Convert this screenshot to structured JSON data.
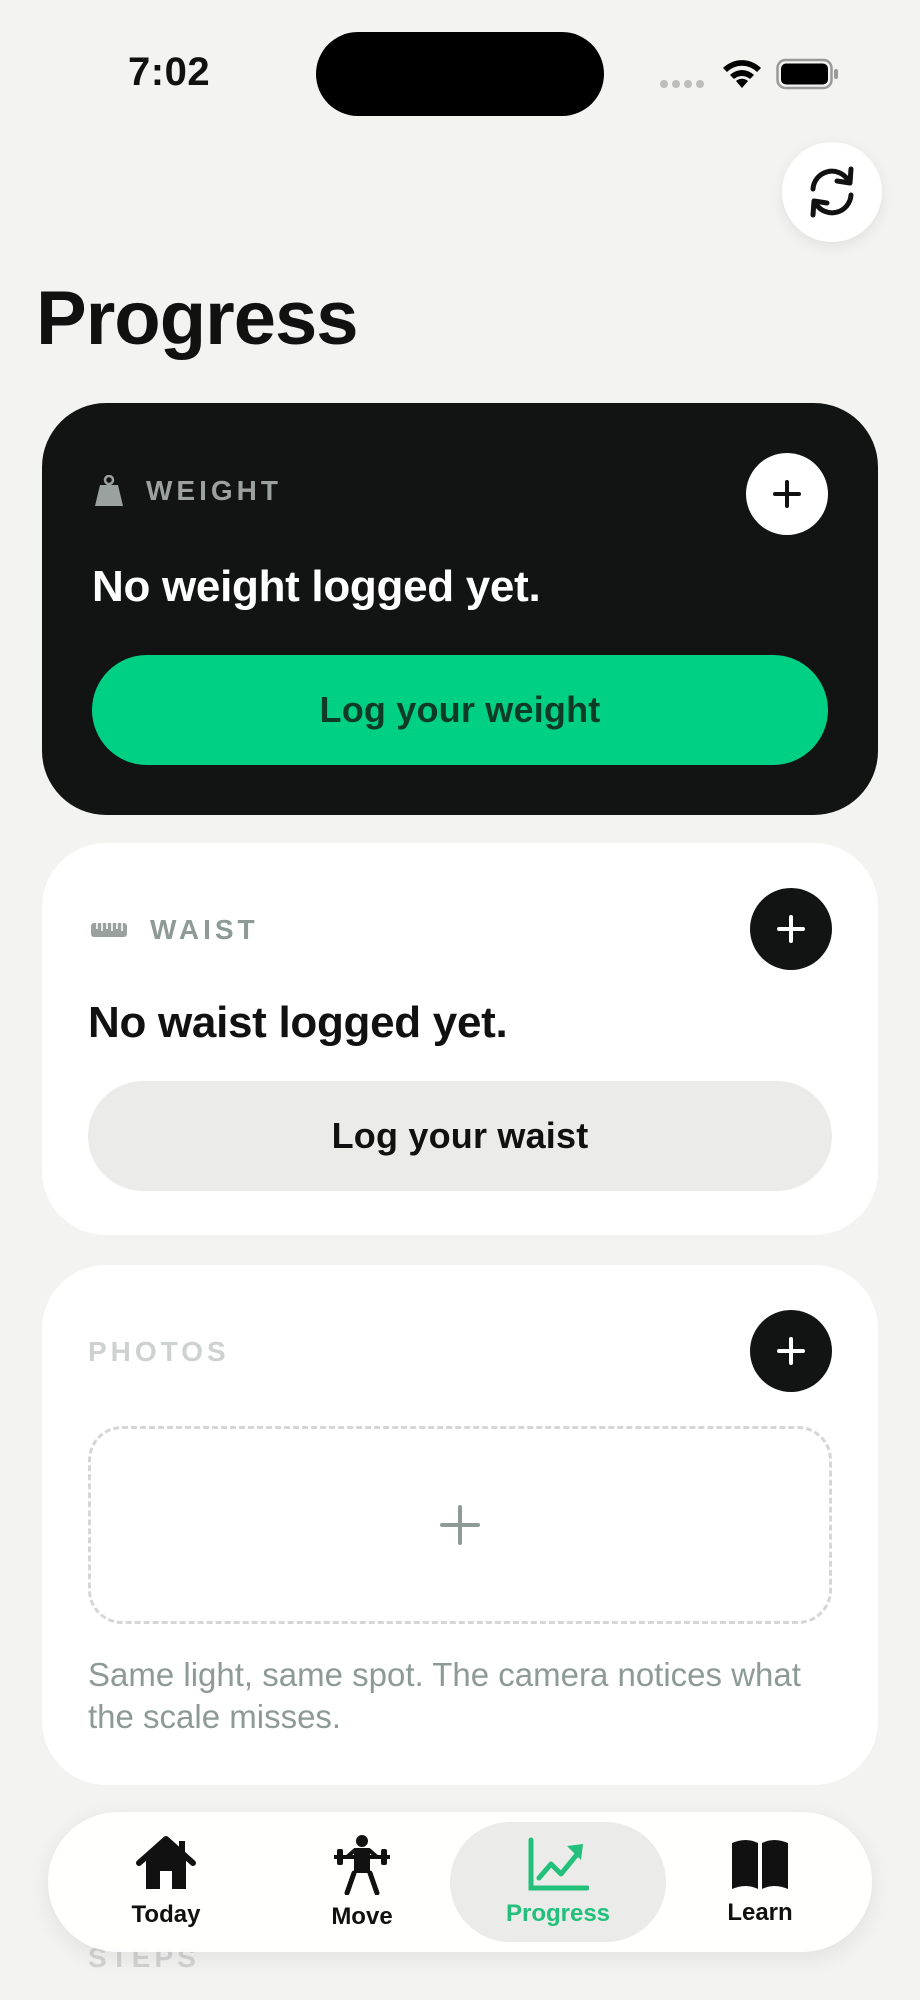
{
  "status_bar": {
    "time": "7:02"
  },
  "header": {
    "title": "Progress"
  },
  "weight_card": {
    "label": "WEIGHT",
    "empty_text": "No weight logged yet.",
    "button_label": "Log your weight"
  },
  "waist_card": {
    "label": "WAIST",
    "empty_text": "No waist logged yet.",
    "button_label": "Log your waist"
  },
  "photos_card": {
    "label": "PHOTOS",
    "hint": "Same light, same spot. The camera notices what the scale misses."
  },
  "next_section": {
    "label": "STEPS"
  },
  "tabs": [
    {
      "label": "Today",
      "icon": "home-icon"
    },
    {
      "label": "Move",
      "icon": "weightlifter-icon"
    },
    {
      "label": "Progress",
      "icon": "chart-up-icon",
      "active": true
    },
    {
      "label": "Learn",
      "icon": "book-icon"
    }
  ],
  "colors": {
    "accent": "#00d084",
    "card_dark": "#121413",
    "background": "#f3f3f2"
  }
}
